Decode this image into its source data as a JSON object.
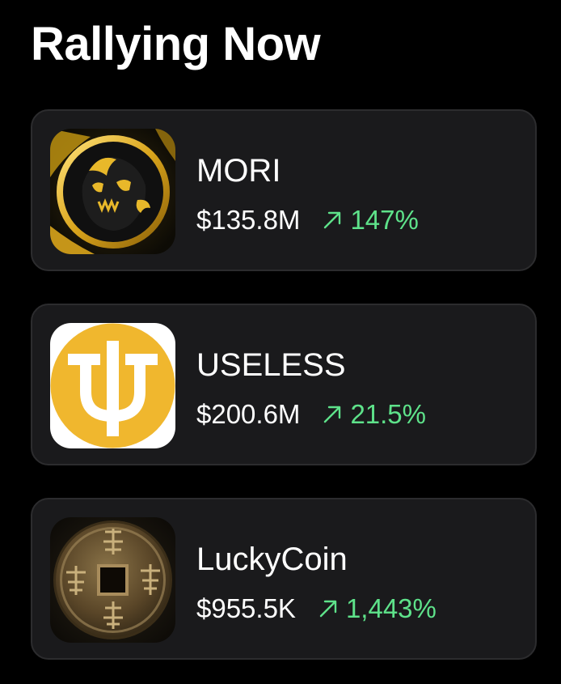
{
  "header": {
    "title": "Rallying Now"
  },
  "colors": {
    "background": "#000000",
    "card": "#1a1a1c",
    "card_border": "#2c2c2e",
    "positive": "#5ee28a",
    "useless_brand": "#f0b72e"
  },
  "tokens": [
    {
      "name": "MORI",
      "market_cap": "$135.8M",
      "change": "147%",
      "trend_icon": "arrow-up-right-icon",
      "logo": "mori-logo"
    },
    {
      "name": "USELESS",
      "market_cap": "$200.6M",
      "change": "21.5%",
      "trend_icon": "arrow-up-right-icon",
      "logo": "useless-logo"
    },
    {
      "name": "LuckyCoin",
      "market_cap": "$955.5K",
      "change": "1,443%",
      "trend_icon": "arrow-up-right-icon",
      "logo": "luckycoin-logo"
    }
  ]
}
